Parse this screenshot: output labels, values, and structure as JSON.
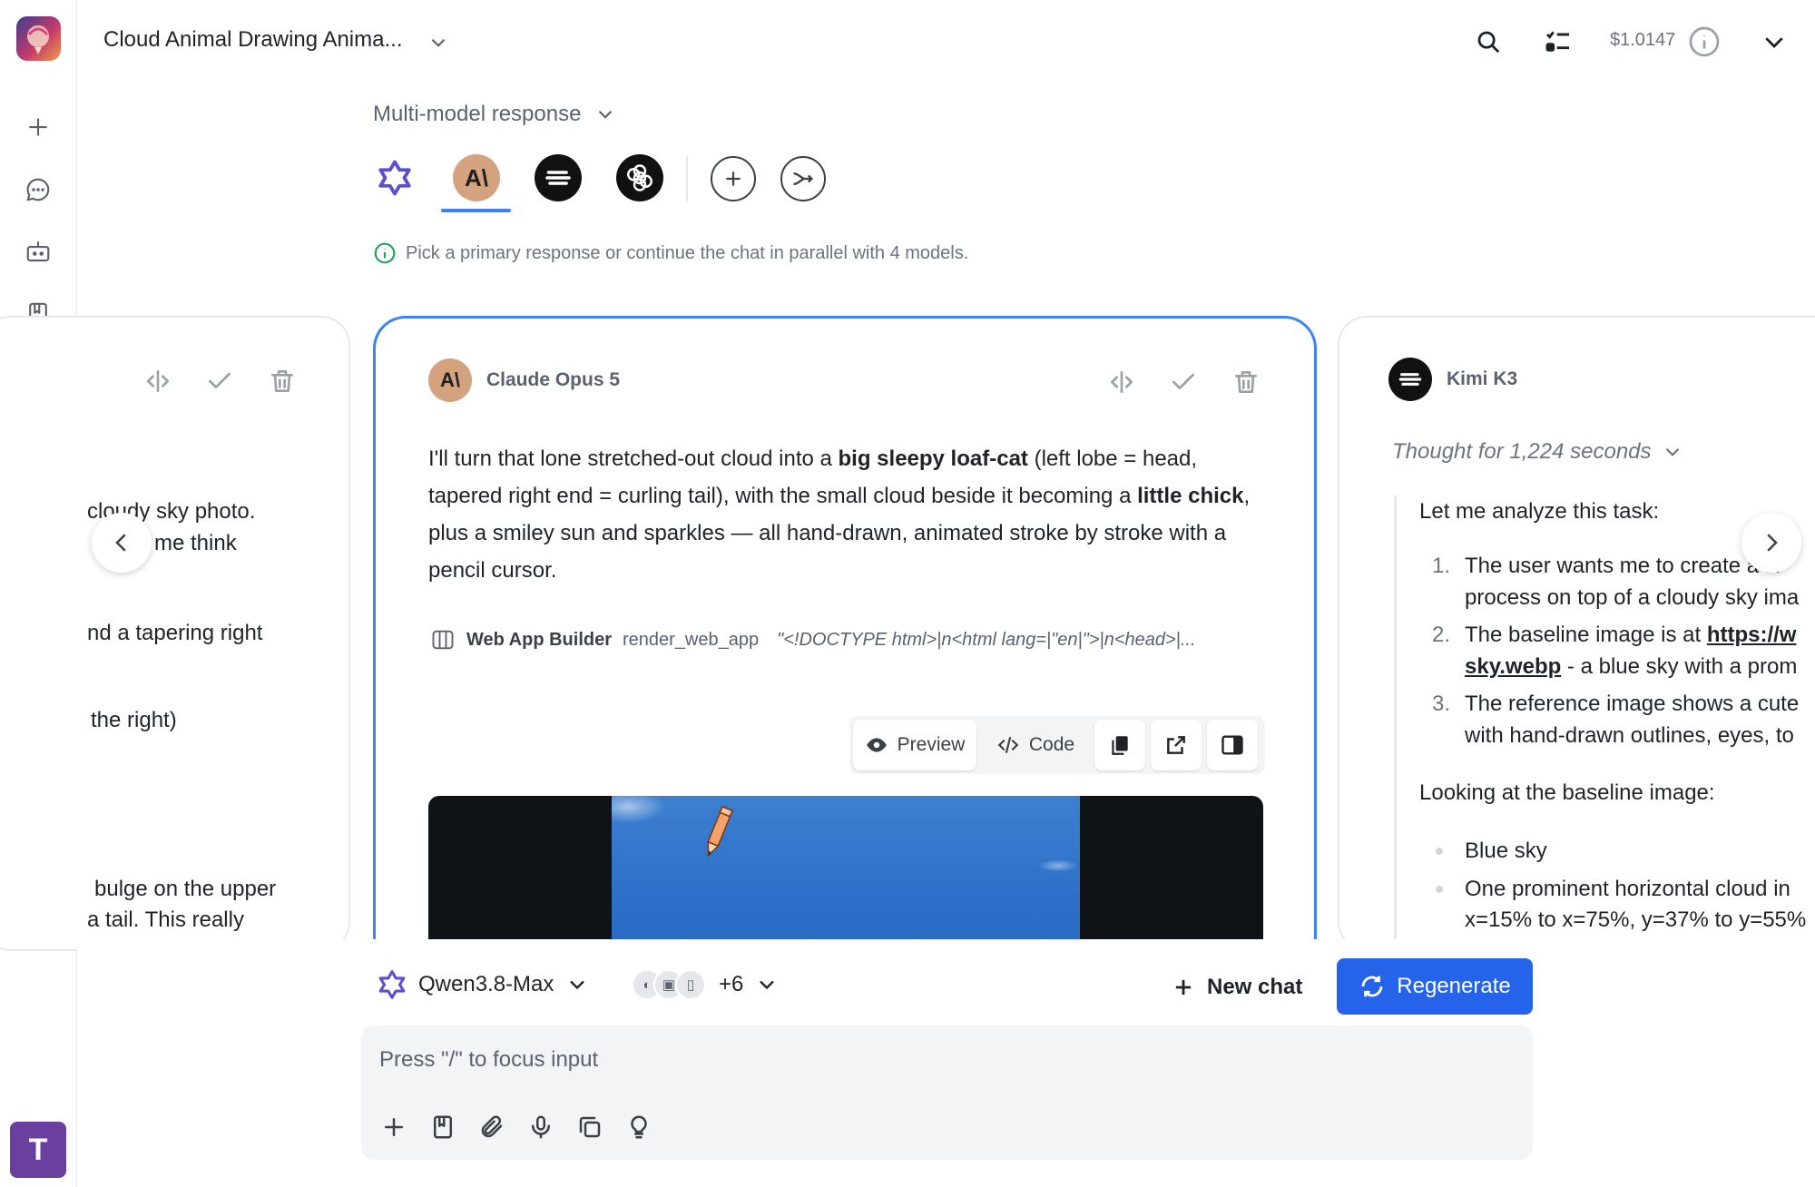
{
  "header": {
    "chat_title": "Cloud Animal Drawing Anima...",
    "cost": "$1.0147"
  },
  "multimodel": {
    "label": "Multi-model response",
    "info": "Pick a primary response or continue the chat in parallel with 4 models.",
    "models": [
      {
        "name": "Qwen",
        "icon": "qwen-icon"
      },
      {
        "name": "Claude",
        "icon": "anthropic-icon"
      },
      {
        "name": "Kimi",
        "icon": "kimi-icon"
      },
      {
        "name": "OpenAI",
        "icon": "openai-icon"
      }
    ]
  },
  "left_card": {
    "lines": [
      "cloudy sky photo.",
      "me think",
      "nd a tapering right",
      "the right)",
      "bulge on the upper",
      "a tail. This really"
    ]
  },
  "mid_card": {
    "model_name": "Claude Opus 5",
    "avatar_text": "A\\",
    "p1": "I'll turn that lone stretched-out cloud into a ",
    "b1": "big sleepy loaf-cat",
    "p2": " (left lobe = head, tapered right end = curling tail), with the small cloud beside it becoming a ",
    "b2": "little chick",
    "p3": ", plus a smiley sun and sparkles — all hand-drawn, animated stroke by stroke with a pencil cursor.",
    "tool_name": "Web App Builder",
    "tool_fn": "render_web_app",
    "tool_arg": "\"<!DOCTYPE html>|n<html lang=|\"en|\">|n<head>|...",
    "preview_label": "Preview",
    "code_label": "Code"
  },
  "right_card": {
    "model_name": "Kimi K3",
    "thought": "Thought for 1,224 seconds",
    "intro": "Let me analyze this task:",
    "items": [
      {
        "num": "1.",
        "l1": "The user wants me to create a H",
        "l2": "process on top of a cloudy sky ima"
      },
      {
        "num": "2.",
        "l1": "The baseline image is at ",
        "link1": "https://w",
        "l2link": "sky.webp",
        "l2": " - a blue sky with a prom"
      },
      {
        "num": "3.",
        "l1": "The reference image shows a cute",
        "l2": "with hand-drawn outlines, eyes, to"
      }
    ],
    "looking": "Looking at the baseline image:",
    "bullets": [
      "Blue sky",
      "One prominent horizontal cloud in"
    ],
    "bullet2_cont": "x=15% to x=75%, y=37% to y=55%"
  },
  "composer": {
    "model": "Qwen3.8-Max",
    "extra_models": "+6",
    "new_chat": "New chat",
    "regenerate": "Regenerate",
    "placeholder": "Press \"/\" to focus input"
  },
  "user": {
    "initial": "T"
  },
  "colors": {
    "accent": "#3b82f6",
    "button": "#2563eb",
    "avatar_claude": "#d4a27f",
    "user_badge": "#6b3fa0"
  }
}
